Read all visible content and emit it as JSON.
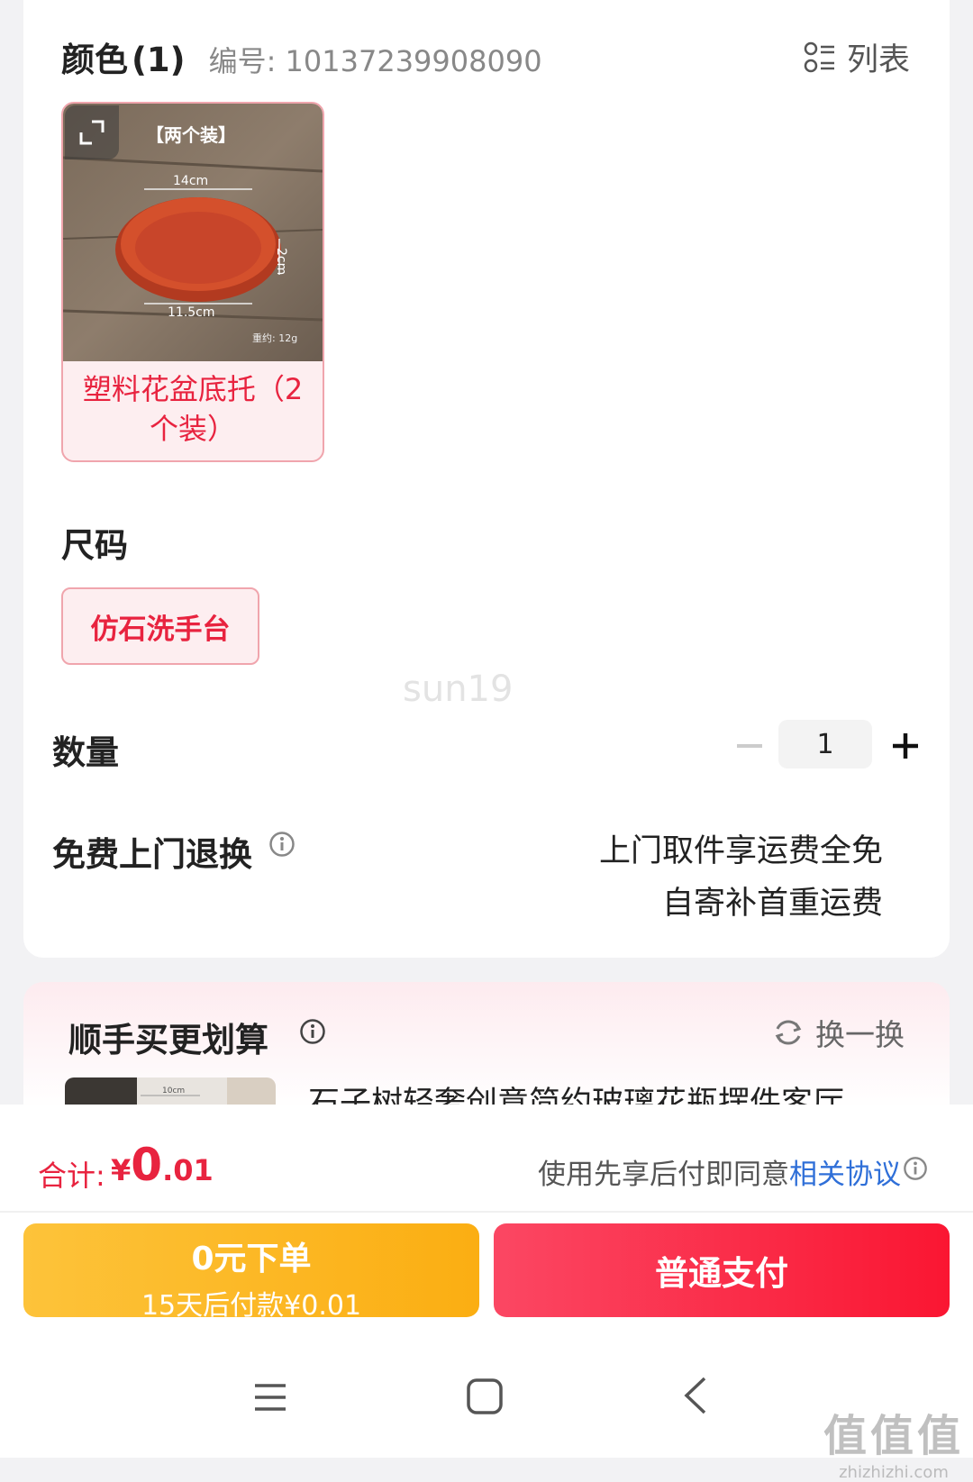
{
  "spec": {
    "color_title": "颜色",
    "color_count": "(1)",
    "sku_label": "编号: 10137239908090",
    "list_toggle_label": "列表",
    "option": {
      "image_caption_top": "【两个装】",
      "dim_width": "14cm",
      "dim_height": "2cm",
      "dim_bottom": "11.5cm",
      "weight": "重约: 12g",
      "name_line1": "塑料花盆底托（2",
      "name_line2": "个装）"
    },
    "size_title": "尺码",
    "size_option": "仿石洗手台",
    "watermark": "sun19",
    "quantity_label": "数量",
    "quantity_value": "1",
    "return_label": "免费上门退换",
    "return_desc_line1": "上门取件享运费全免",
    "return_desc_line2": "自寄补首重运费"
  },
  "recommend": {
    "title": "顺手买更划算",
    "refresh_label": "换一换",
    "item_thumb_caption": "10cm",
    "item_name": "石子树轻奢创意简约玻璃花瓶摆件客厅"
  },
  "footer": {
    "total_label": "合计:",
    "currency": "¥",
    "total_int": "0",
    "total_dec": ".01",
    "agree_text": "使用先享后付即同意",
    "agree_link": "相关协议",
    "bnpl_main": "0元下单",
    "bnpl_sub": "15天后付款¥0.01",
    "pay_label": "普通支付"
  },
  "corner_watermark": {
    "big": "值值值",
    "small": "zhizhizhi.com"
  },
  "colors": {
    "accent_red": "#e8233f",
    "pay_red": "#fa1632",
    "bnpl_yellow": "#fbae12",
    "link_blue": "#2f6fd8"
  }
}
